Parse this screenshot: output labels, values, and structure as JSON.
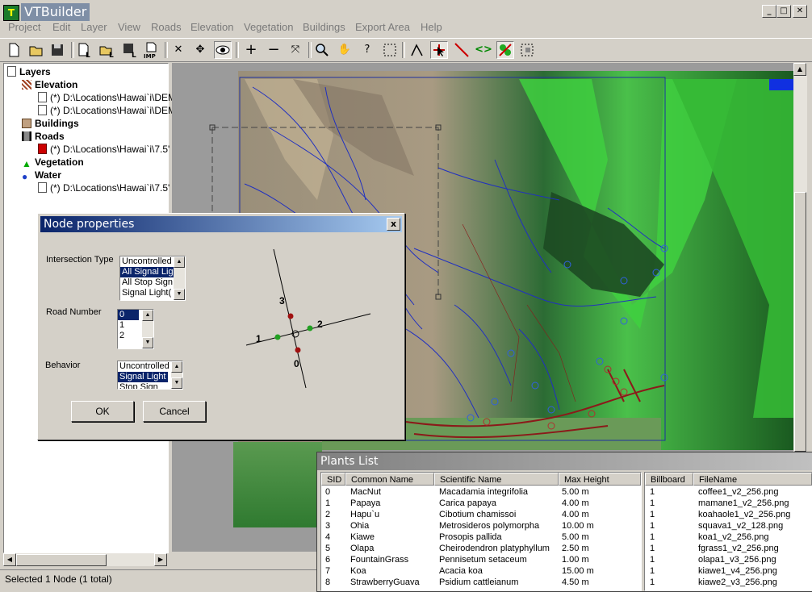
{
  "app": {
    "title": "VTBuilder",
    "icon_letter": "T"
  },
  "window_buttons": {
    "minimize": "_",
    "maximize": "□",
    "close": "✕"
  },
  "menu": [
    "Project",
    "Edit",
    "Layer",
    "View",
    "Roads",
    "Elevation",
    "Vegetation",
    "Buildings",
    "Export Area",
    "Help"
  ],
  "toolbar_icons": [
    "new-icon",
    "open-icon",
    "save-icon",
    "new-layer-icon",
    "open-layer-icon",
    "save-layer-icon",
    "import-icon",
    "delete-icon",
    "pan-move-icon",
    "visibility-eye-icon",
    "zoom-in-icon",
    "zoom-out-icon",
    "zoom-all-icon",
    "magnify-icon",
    "hand-icon",
    "info-icon",
    "select-area-icon",
    "edit-road-icon",
    "select-node-icon",
    "distance-icon",
    "edit-points-icon",
    "vegetation-icon",
    "export-icon"
  ],
  "tree": {
    "root": "Layers",
    "groups": [
      {
        "label": "Elevation",
        "items": [
          "(*) D:\\Locations\\Hawai`i\\DEM",
          "(*) D:\\Locations\\Hawai`i\\DEM"
        ]
      },
      {
        "label": "Buildings",
        "items": []
      },
      {
        "label": "Roads",
        "items": [
          "(*) D:\\Locations\\Hawai`i\\7.5'"
        ]
      },
      {
        "label": "Vegetation",
        "items": []
      },
      {
        "label": "Water",
        "items": [
          "(*) D:\\Locations\\Hawai`i\\7.5'"
        ]
      }
    ]
  },
  "status": {
    "text": "Selected 1 Node (1 total)"
  },
  "dialog": {
    "title": "Node properties",
    "close": "x",
    "intersection_label": "Intersection Type",
    "intersection_options": [
      "Uncontrolled",
      "All Signal Lig",
      "All Stop Sign",
      "Signal Light("
    ],
    "intersection_selected": 1,
    "road_label": "Road Number",
    "road_options": [
      "0",
      "1",
      "2"
    ],
    "road_selected": 0,
    "behavior_label": "Behavior",
    "behavior_options": [
      "Uncontrolled",
      "Signal Light",
      "Stop Sign"
    ],
    "behavior_selected": 1,
    "diagram_labels": [
      "3",
      "2",
      "1",
      "0"
    ],
    "ok": "OK",
    "cancel": "Cancel"
  },
  "plants": {
    "title": "Plants List",
    "columns": [
      "SID",
      "Common Name",
      "Scientific Name",
      "Max Height"
    ],
    "rows": [
      [
        "0",
        "MacNut",
        "Macadamia integrifolia",
        "5.00 m"
      ],
      [
        "1",
        "Papaya",
        "Carica papaya",
        "4.00 m"
      ],
      [
        "2",
        "Hapu`u",
        "Cibotium chamissoi",
        "4.00 m"
      ],
      [
        "3",
        "Ohia",
        "Metrosideros polymorpha",
        "10.00 m"
      ],
      [
        "4",
        "Kiawe",
        "Prosopis pallida",
        "5.00 m"
      ],
      [
        "5",
        "Olapa",
        "Cheirodendron platyphyllum",
        "2.50 m"
      ],
      [
        "6",
        "FountainGrass",
        "Pennisetum setaceum",
        "1.00 m"
      ],
      [
        "7",
        "Koa",
        "Acacia koa",
        "15.00 m"
      ],
      [
        "8",
        "StrawberryGuava",
        "Psidium cattleianum",
        "4.50 m"
      ]
    ],
    "file_columns": [
      "Billboard",
      "FileName"
    ],
    "files": [
      [
        "1",
        "coffee1_v2_256.png"
      ],
      [
        "1",
        "mamane1_v2_256.png"
      ],
      [
        "1",
        "koahaole1_v2_256.png"
      ],
      [
        "1",
        "squava1_v2_128.png"
      ],
      [
        "1",
        "koa1_v2_256.png"
      ],
      [
        "1",
        "fgrass1_v2_256.png"
      ],
      [
        "1",
        "olapa1_v3_256.png"
      ],
      [
        "1",
        "kiawe1_v4_256.png"
      ],
      [
        "1",
        "kiawe2_v3_256.png"
      ]
    ]
  },
  "colors": {
    "selection": "#0a246a",
    "road": "#8b1a1a",
    "water": "#1e40c8",
    "node_red": "#a01010",
    "node_green": "#22a022"
  }
}
